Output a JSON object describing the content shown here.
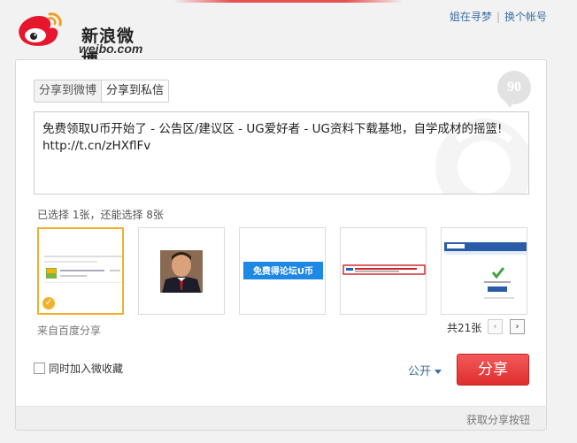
{
  "brand": {
    "name_cn": "新浪微博",
    "name_en": "weibo.com"
  },
  "top_links": {
    "user": "姐在寻梦",
    "switch_account": "换个帐号"
  },
  "tabs": [
    {
      "label": "分享到微博",
      "active": true
    },
    {
      "label": "分享到私信",
      "active": false
    }
  ],
  "char_counter": "90",
  "message": {
    "line1": "免费领取U币开始了 - 公告区/建议区 - UG爱好者 - UG资料下载基地，自学成材的摇篮!",
    "line2": "http://t.cn/zHXflFv"
  },
  "selected_info": "已选择 1张，还能选择 8张",
  "thumbnails": [
    {
      "id": "1",
      "selected": true,
      "desc": "forum page screenshot"
    },
    {
      "id": "2",
      "selected": false,
      "desc": "portrait photo"
    },
    {
      "id": "3",
      "selected": false,
      "banner_text": "免费得论坛U币"
    },
    {
      "id": "4",
      "selected": false,
      "desc": "red bordered notice"
    },
    {
      "id": "5",
      "selected": false,
      "desc": "renren login page"
    }
  ],
  "source_label": "来自百度分享",
  "total_count": "共21张",
  "pager": {
    "prev": "‹",
    "next": "›"
  },
  "add_to_favorites": "同时加入微收藏",
  "visibility": "公开",
  "share_button": "分享",
  "get_share_button": "获取分享按钮",
  "colors": {
    "accent_red": "#e02d2d",
    "link_blue": "#3b6ea5",
    "selected_border": "#f0b12e"
  }
}
